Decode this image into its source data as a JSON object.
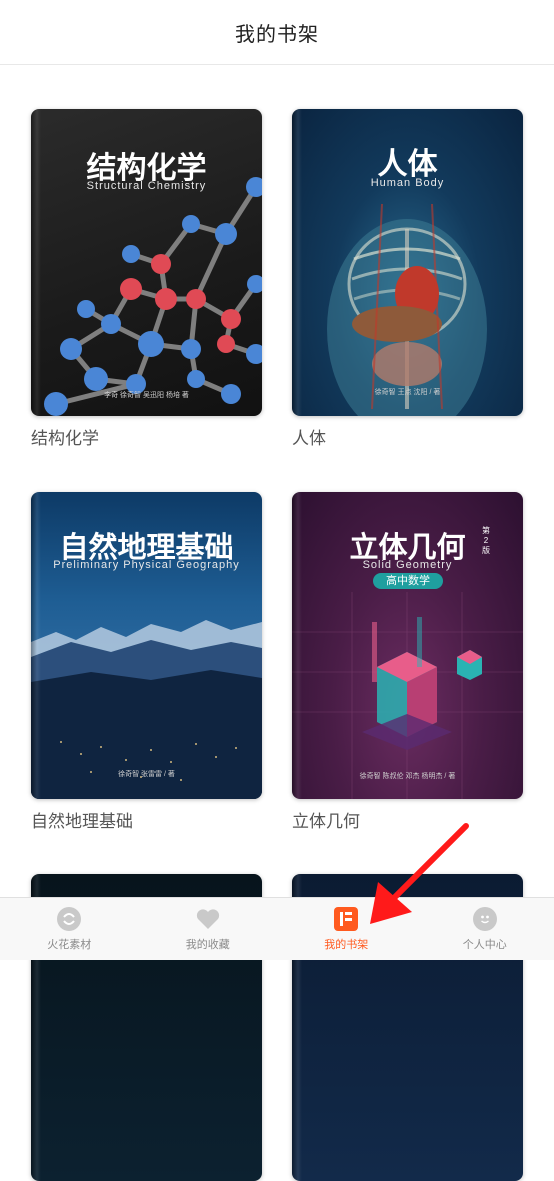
{
  "header": {
    "title": "我的书架"
  },
  "books": [
    {
      "cover_title": "结构化学",
      "cover_subtitle": "Structural Chemistry",
      "cover_authors": "李奇 徐奇智 吴迅阳 杨培 著",
      "label": "结构化学"
    },
    {
      "cover_title": "人体",
      "cover_subtitle": "Human Body",
      "cover_authors": "徐奇智 王点 沈阳 / 著",
      "label": "人体"
    },
    {
      "cover_title": "自然地理基础",
      "cover_subtitle": "Preliminary Physical Geography",
      "cover_authors": "徐奇智 张雷雷 / 著",
      "label": "自然地理基础"
    },
    {
      "cover_title": "立体几何",
      "cover_edition": "第2版",
      "cover_subtitle": "Solid Geometry",
      "cover_badge": "高中数学",
      "cover_authors": "徐奇智 陈叔伦 邓杰 杨明杰 / 著",
      "label": "立体几何"
    }
  ],
  "tabbar": {
    "tabs": [
      {
        "label": "火花素材",
        "icon": "spark-icon",
        "active": false
      },
      {
        "label": "我的收藏",
        "icon": "heart-icon",
        "active": false
      },
      {
        "label": "我的书架",
        "icon": "bookshelf-icon",
        "active": true
      },
      {
        "label": "个人中心",
        "icon": "smiley-icon",
        "active": false
      }
    ]
  },
  "colors": {
    "accent": "#ff5a1f",
    "annotation_arrow": "#ff1a1a",
    "inactive": "#c9c9c9"
  }
}
